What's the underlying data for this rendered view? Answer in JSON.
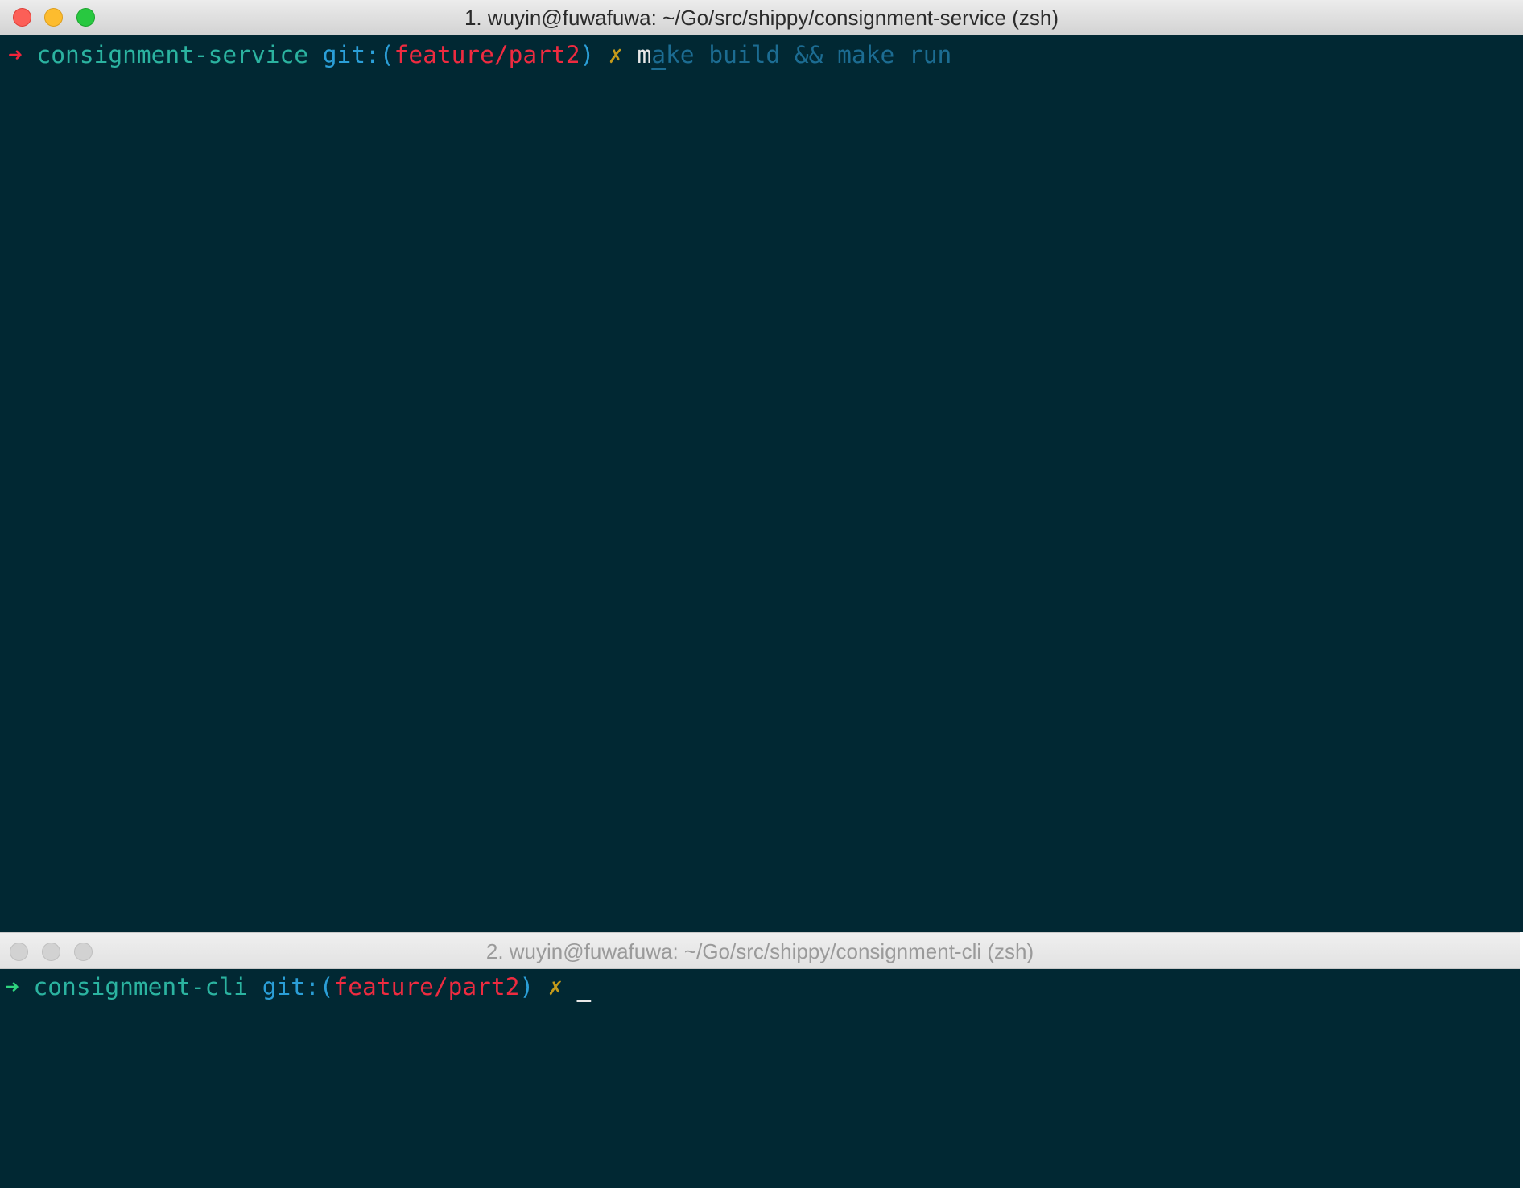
{
  "windows": [
    {
      "title": "1. wuyin@fuwafuwa: ~/Go/src/shippy/consignment-service (zsh)",
      "focused": true,
      "prompt": {
        "arrow": "➜",
        "directory": "consignment-service",
        "git_label": "git:(",
        "branch": "feature/part2",
        "git_close": ")",
        "dirty_marker": "✗",
        "typed": "m",
        "cursor_char": "a",
        "autosuggestion": "ke build && make run"
      }
    },
    {
      "title": "2. wuyin@fuwafuwa: ~/Go/src/shippy/consignment-cli (zsh)",
      "focused": false,
      "prompt": {
        "arrow": "➜",
        "directory": "consignment-cli",
        "git_label": "git:(",
        "branch": "feature/part2",
        "git_close": ")",
        "dirty_marker": "✗",
        "cursor_char": " "
      }
    }
  ],
  "colors": {
    "terminal_background": "#012833",
    "arrow_error": "#f0243b",
    "arrow_success": "#2ed47e",
    "directory": "#2bb3a0",
    "git_label": "#2b9fd8",
    "branch": "#ee2b40",
    "dirty_marker": "#c49a1a",
    "autosuggestion": "#1c6c92"
  }
}
